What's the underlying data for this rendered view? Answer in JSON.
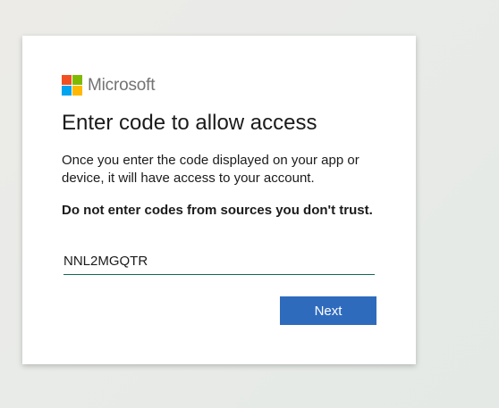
{
  "brand": {
    "name": "Microsoft",
    "logo_colors": [
      "#f25022",
      "#7fba00",
      "#00a4ef",
      "#ffb900"
    ]
  },
  "page": {
    "title": "Enter code to allow access",
    "description": "Once you enter the code displayed on your app or device, it will have access to your account.",
    "warning": "Do not enter codes from sources you don't trust."
  },
  "code_field": {
    "value": "NNL2MGQTR",
    "accent_color": "#0f6a57"
  },
  "actions": {
    "next_label": "Next",
    "next_color": "#2f6bbd"
  }
}
